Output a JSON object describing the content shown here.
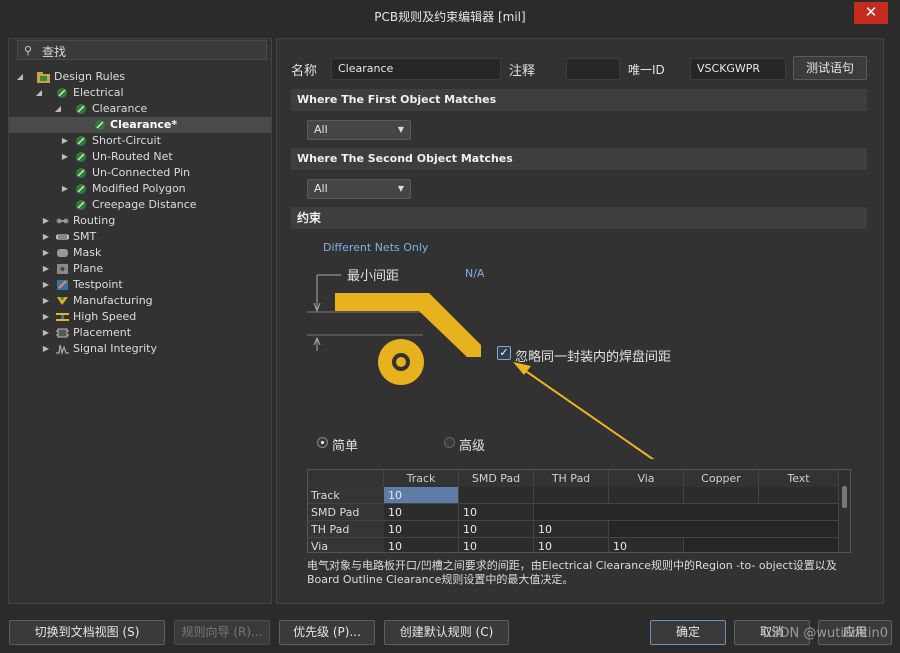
{
  "window": {
    "title": "PCB规则及约束编辑器 [mil]",
    "close_glyph": "✕"
  },
  "search": {
    "label": "查找"
  },
  "tree": [
    {
      "label": "Design Rules"
    },
    {
      "label": "Electrical"
    },
    {
      "label": "Clearance"
    },
    {
      "label": "Clearance*"
    },
    {
      "label": "Short-Circuit"
    },
    {
      "label": "Un-Routed Net"
    },
    {
      "label": "Un-Connected Pin"
    },
    {
      "label": "Modified Polygon"
    },
    {
      "label": "Creepage Distance"
    },
    {
      "label": "Routing"
    },
    {
      "label": "SMT"
    },
    {
      "label": "Mask"
    },
    {
      "label": "Plane"
    },
    {
      "label": "Testpoint"
    },
    {
      "label": "Manufacturing"
    },
    {
      "label": "High Speed"
    },
    {
      "label": "Placement"
    },
    {
      "label": "Signal Integrity"
    }
  ],
  "rule": {
    "name_label": "名称",
    "name_value": "Clearance",
    "comment_label": "注释",
    "comment_value": "",
    "id_label": "唯一ID",
    "id_value": "VSCKGWPR",
    "test_button": "测试语句"
  },
  "first_match": {
    "title": "Where The First Object Matches",
    "value": "All"
  },
  "second_match": {
    "title": "Where The Second Object Matches",
    "value": "All"
  },
  "constraints": {
    "title": "约束",
    "net_scope": "Different Nets Only",
    "min_clearance_label": "最小间距",
    "min_clearance_value": "N/A",
    "ignore_pad_label": "忽略同一封装内的焊盘间距",
    "ignore_pad_checked": true,
    "mode_simple": "简单",
    "mode_advanced": "高级",
    "mode_selected": "简单"
  },
  "grid": {
    "columns": [
      "Track",
      "SMD Pad",
      "TH Pad",
      "Via",
      "Copper",
      "Text"
    ],
    "rows": [
      {
        "name": "Track",
        "values": [
          "10",
          "",
          "",
          "",
          "",
          ""
        ]
      },
      {
        "name": "SMD Pad",
        "values": [
          "10",
          "10",
          "",
          "",
          "",
          ""
        ]
      },
      {
        "name": "TH Pad",
        "values": [
          "10",
          "10",
          "10",
          "",
          "",
          ""
        ]
      },
      {
        "name": "Via",
        "values": [
          "10",
          "10",
          "10",
          "10",
          "",
          ""
        ]
      }
    ]
  },
  "description": "电气对象与电路板开口/凹槽之间要求的间距，由Electrical Clearance规则中的Region -to- object设置以及Board Outline Clearance规则设置中的最大值决定。",
  "buttons": {
    "doc_view": "切换到文档视图 (S)",
    "wizard": "规则向导 (R)...",
    "priority": "优先级 (P)...",
    "create_default": "创建默认规则 (C)",
    "ok": "确定",
    "cancel": "取消",
    "apply": "应用"
  },
  "watermark": "CSDN @wutianxin0",
  "colors": {
    "trace": "#e8b21e",
    "arrow": "#f0b420",
    "accent": "#5d7da6"
  }
}
